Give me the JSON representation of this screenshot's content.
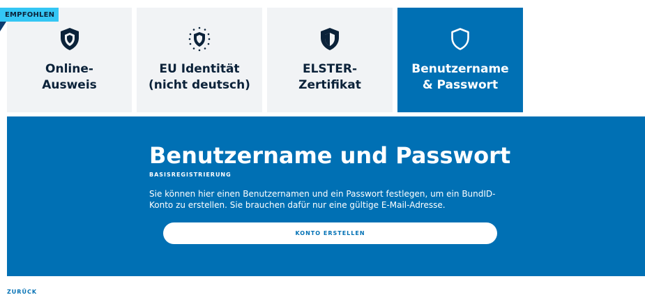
{
  "badge": {
    "label": "EMPFOHLEN"
  },
  "tabs": [
    {
      "label": "Online-\nAusweis",
      "icon": "shield-filled-icon",
      "active": false
    },
    {
      "label": "EU Identität\n(nicht deutsch)",
      "icon": "eu-stars-shield-icon",
      "active": false
    },
    {
      "label": "ELSTER-\nZertifikat",
      "icon": "shield-half-icon",
      "active": false
    },
    {
      "label": "Benutzername\n& Passwort",
      "icon": "shield-outline-icon",
      "active": true
    }
  ],
  "panel": {
    "title": "Benutzername und Passwort",
    "subtitle": "BASISREGISTRIERUNG",
    "description": "Sie können hier einen Benutzernamen und ein Passwort festlegen, um ein BundID-Konto zu erstellen. Sie brauchen dafür nur eine gültige E-Mail-Adresse.",
    "cta_label": "KONTO ERSTELLEN"
  },
  "back_label": "ZURÜCK",
  "colors": {
    "primary": "#0070b4",
    "tab_bg": "#f1f3f5",
    "badge": "#34c6f4",
    "text_dark": "#0b2239"
  }
}
